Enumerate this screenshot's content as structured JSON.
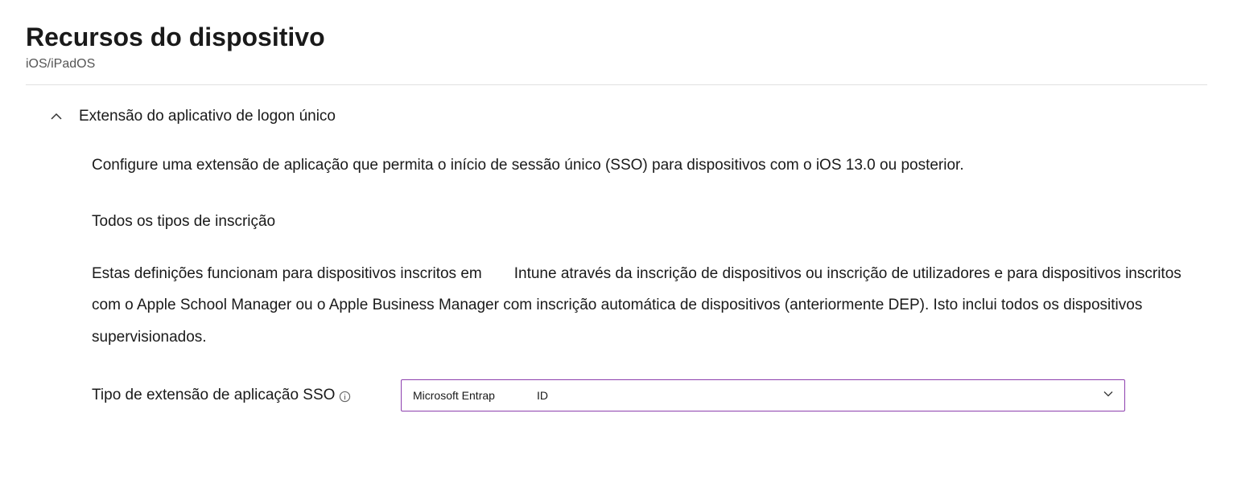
{
  "header": {
    "title": "Recursos do dispositivo",
    "subtitle": "iOS/iPadOS"
  },
  "section": {
    "title": "Extensão do aplicativo de logon único",
    "description": "Configure uma extensão de aplicação que permita o início de sessão único (SSO) para dispositivos com o iOS 13.0 ou posterior.",
    "subheading": "Todos os tipos de inscrição",
    "long_desc_part1": "Estas definições funcionam para dispositivos inscritos em",
    "long_desc_part2": "Intune através da inscrição de dispositivos ou inscrição de utilizadores e para dispositivos inscritos com o Apple School Manager ou o Apple Business Manager com inscrição automática de dispositivos (anteriormente DEP). Isto inclui todos os dispositivos supervisionados."
  },
  "form": {
    "sso_type_label": "Tipo de extensão de aplicação SSO",
    "sso_type_value_part1": "Microsoft Entrap",
    "sso_type_value_part2": "ID"
  }
}
